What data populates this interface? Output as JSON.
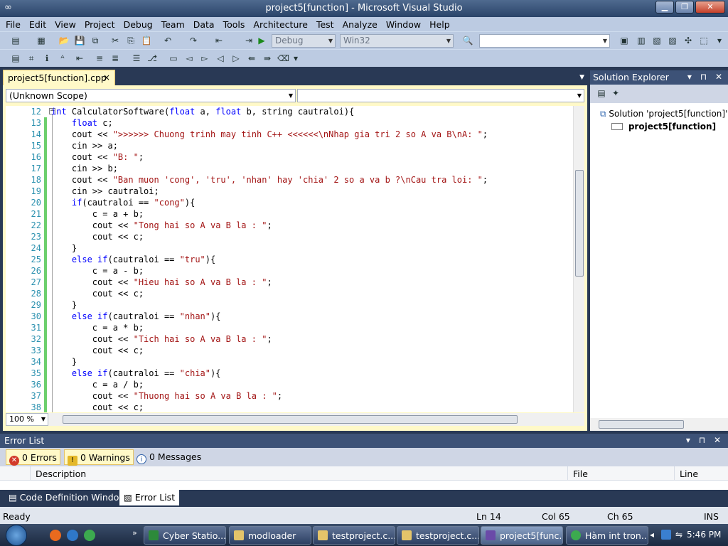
{
  "window": {
    "title": "project5[function] - Microsoft Visual Studio",
    "buttons": [
      "minimize",
      "maximize",
      "close"
    ]
  },
  "menu": [
    "File",
    "Edit",
    "View",
    "Project",
    "Debug",
    "Team",
    "Data",
    "Tools",
    "Architecture",
    "Test",
    "Analyze",
    "Window",
    "Help"
  ],
  "toolbar": {
    "config": "Debug",
    "platform": "Win32",
    "find_value": ""
  },
  "doc_tab": {
    "label": "project5[function].cpp",
    "close": "×"
  },
  "scope": {
    "left": "(Unknown Scope)",
    "right": ""
  },
  "editor": {
    "line_numbers": [
      "12",
      "13",
      "14",
      "15",
      "16",
      "17",
      "18",
      "19",
      "20",
      "21",
      "22",
      "23",
      "24",
      "25",
      "26",
      "27",
      "28",
      "29",
      "30",
      "31",
      "32",
      "33",
      "34",
      "35",
      "36",
      "37",
      "38"
    ],
    "zoom": "100 %",
    "code": [
      [
        {
          "t": "kw",
          "v": "int"
        },
        {
          "t": "p",
          "v": " CalculatorSoftware("
        },
        {
          "t": "kw",
          "v": "float"
        },
        {
          "t": "p",
          "v": " a, "
        },
        {
          "t": "kw",
          "v": "float"
        },
        {
          "t": "p",
          "v": " b, string cautraloi){"
        }
      ],
      [
        {
          "t": "p",
          "v": "    "
        },
        {
          "t": "kw",
          "v": "float"
        },
        {
          "t": "p",
          "v": " c;"
        }
      ],
      [
        {
          "t": "p",
          "v": "    cout << "
        },
        {
          "t": "str",
          "v": "\">>>>>> Chuong trinh may tinh C++ <<<<<<\\nNhap gia tri 2 so A va B\\nA: \""
        },
        {
          "t": "p",
          "v": ";"
        }
      ],
      [
        {
          "t": "p",
          "v": "    cin >> a;"
        }
      ],
      [
        {
          "t": "p",
          "v": "    cout << "
        },
        {
          "t": "str",
          "v": "\"B: \""
        },
        {
          "t": "p",
          "v": ";"
        }
      ],
      [
        {
          "t": "p",
          "v": "    cin >> b;"
        }
      ],
      [
        {
          "t": "p",
          "v": "    cout << "
        },
        {
          "t": "str",
          "v": "\"Ban muon 'cong', 'tru', 'nhan' hay 'chia' 2 so a va b ?\\nCau tra loi: \""
        },
        {
          "t": "p",
          "v": ";"
        }
      ],
      [
        {
          "t": "p",
          "v": "    cin >> cautraloi;"
        }
      ],
      [
        {
          "t": "p",
          "v": "    "
        },
        {
          "t": "kw",
          "v": "if"
        },
        {
          "t": "p",
          "v": "(cautraloi == "
        },
        {
          "t": "str",
          "v": "\"cong\""
        },
        {
          "t": "p",
          "v": "){"
        }
      ],
      [
        {
          "t": "p",
          "v": "        c = a + b;"
        }
      ],
      [
        {
          "t": "p",
          "v": "        cout << "
        },
        {
          "t": "str",
          "v": "\"Tong hai so A va B la : \""
        },
        {
          "t": "p",
          "v": ";"
        }
      ],
      [
        {
          "t": "p",
          "v": "        cout << c;"
        }
      ],
      [
        {
          "t": "p",
          "v": "    }"
        }
      ],
      [
        {
          "t": "p",
          "v": "    "
        },
        {
          "t": "kw",
          "v": "else if"
        },
        {
          "t": "p",
          "v": "(cautraloi == "
        },
        {
          "t": "str",
          "v": "\"tru\""
        },
        {
          "t": "p",
          "v": "){"
        }
      ],
      [
        {
          "t": "p",
          "v": "        c = a - b;"
        }
      ],
      [
        {
          "t": "p",
          "v": "        cout << "
        },
        {
          "t": "str",
          "v": "\"Hieu hai so A va B la : \""
        },
        {
          "t": "p",
          "v": ";"
        }
      ],
      [
        {
          "t": "p",
          "v": "        cout << c;"
        }
      ],
      [
        {
          "t": "p",
          "v": "    }"
        }
      ],
      [
        {
          "t": "p",
          "v": "    "
        },
        {
          "t": "kw",
          "v": "else if"
        },
        {
          "t": "p",
          "v": "(cautraloi == "
        },
        {
          "t": "str",
          "v": "\"nhan\""
        },
        {
          "t": "p",
          "v": "){"
        }
      ],
      [
        {
          "t": "p",
          "v": "        c = a * b;"
        }
      ],
      [
        {
          "t": "p",
          "v": "        cout << "
        },
        {
          "t": "str",
          "v": "\"Tich hai so A va B la : \""
        },
        {
          "t": "p",
          "v": ";"
        }
      ],
      [
        {
          "t": "p",
          "v": "        cout << c;"
        }
      ],
      [
        {
          "t": "p",
          "v": "    }"
        }
      ],
      [
        {
          "t": "p",
          "v": "    "
        },
        {
          "t": "kw",
          "v": "else if"
        },
        {
          "t": "p",
          "v": "(cautraloi == "
        },
        {
          "t": "str",
          "v": "\"chia\""
        },
        {
          "t": "p",
          "v": "){"
        }
      ],
      [
        {
          "t": "p",
          "v": "        c = a / b;"
        }
      ],
      [
        {
          "t": "p",
          "v": "        cout << "
        },
        {
          "t": "str",
          "v": "\"Thuong hai so A va B la : \""
        },
        {
          "t": "p",
          "v": ";"
        }
      ],
      [
        {
          "t": "p",
          "v": "        cout << c;"
        }
      ]
    ]
  },
  "solution_explorer": {
    "title": "Solution Explorer",
    "solution": "Solution 'project5[function]' (",
    "project": "project5[function]"
  },
  "error_list": {
    "title": "Error List",
    "errors": "0 Errors",
    "warnings": "0 Warnings",
    "messages": "0 Messages",
    "columns": {
      "description": "Description",
      "file": "File",
      "line": "Line"
    }
  },
  "bottom_tabs": {
    "code_def": "Code Definition Window",
    "error_list": "Error List"
  },
  "status": {
    "ready": "Ready",
    "ln": "Ln 14",
    "col": "Col 65",
    "ch": "Ch 65",
    "ins": "INS"
  },
  "taskbar": {
    "tasks": [
      "Cyber Statio...",
      "modloader",
      "testproject.c...",
      "testproject.c...",
      "project5[func...",
      "Hàm int tron..."
    ],
    "time": "5:46 PM"
  },
  "colors": {
    "keyword": "#0000ff",
    "string": "#a31515",
    "line_number": "#2b91af",
    "changed": "#6dcf6d",
    "tab_active": "#fff9c8",
    "panel_head": "#3d5277"
  }
}
